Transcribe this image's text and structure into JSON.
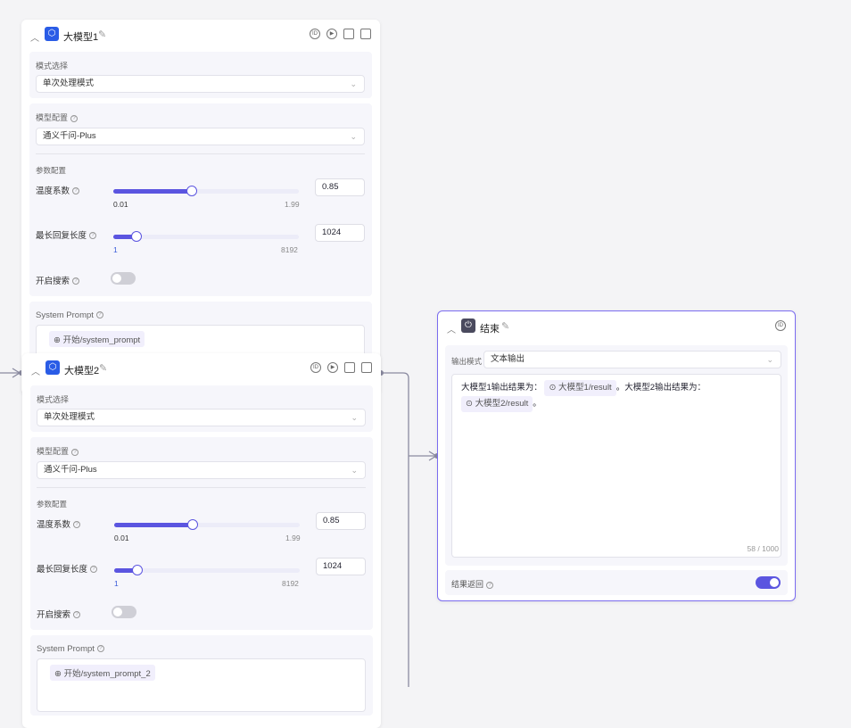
{
  "cards": [
    {
      "title": "大模型1",
      "mode_label": "模式选择",
      "mode_value": "单次处理模式",
      "model_label": "模型配置",
      "model_value": "通义千问-Plus",
      "params_label": "参数配置",
      "temp_label": "温度系数",
      "temp_value": "0.85",
      "temp_min": "0.01",
      "temp_max": "1.99",
      "temp_fraction": 0.425,
      "len_label": "最长回复长度",
      "len_value": "1024",
      "len_min": "1",
      "len_max": "8192",
      "len_fraction": 0.125,
      "search_label": "开启搜索",
      "search_on": false,
      "prompt_label": "System Prompt",
      "prompt_tag": "开始/system_prompt"
    },
    {
      "title": "大模型2",
      "mode_label": "模式选择",
      "mode_value": "单次处理模式",
      "model_label": "模型配置",
      "model_value": "通义千问-Plus",
      "params_label": "参数配置",
      "temp_label": "温度系数",
      "temp_value": "0.85",
      "temp_min": "0.01",
      "temp_max": "1.99",
      "temp_fraction": 0.425,
      "len_label": "最长回复长度",
      "len_value": "1024",
      "len_min": "1",
      "len_max": "8192",
      "len_fraction": 0.125,
      "search_label": "开启搜索",
      "search_on": false,
      "prompt_label": "System Prompt",
      "prompt_tag": "开始/system_prompt_2"
    }
  ],
  "end": {
    "title": "结束",
    "output_mode_label": "输出模式",
    "output_mode_value": "文本输出",
    "text1": "大模型1输出结果为：",
    "tag1": "大模型1/result",
    "sep": "。大模型2输出结果为：",
    "tag2": "大模型2/result",
    "text_end": "。",
    "counter": "58 / 1000",
    "return_label": "结果返回",
    "return_on": true
  },
  "accent": "#5b55e0"
}
